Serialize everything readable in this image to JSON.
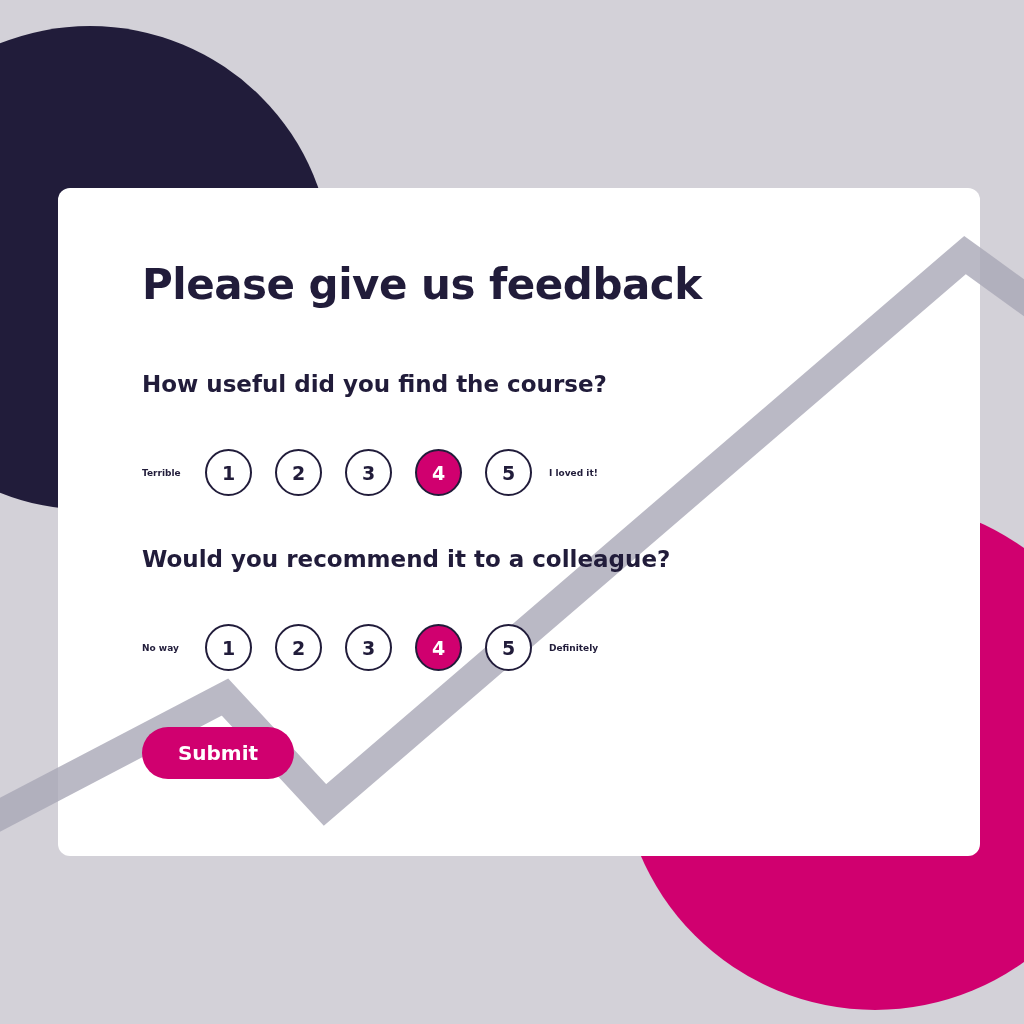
{
  "form": {
    "title": "Please give us feedback",
    "questions": [
      {
        "text": "How useful did you find the course?",
        "low_label": "Terrible",
        "high_label": "I loved it!",
        "options": [
          {
            "label": "1",
            "selected": false
          },
          {
            "label": "2",
            "selected": false
          },
          {
            "label": "3",
            "selected": false
          },
          {
            "label": "4",
            "selected": true
          },
          {
            "label": "5",
            "selected": false
          }
        ]
      },
      {
        "text": "Would you recommend it to a colleague?",
        "low_label": "No way",
        "high_label": "Definitely",
        "options": [
          {
            "label": "1",
            "selected": false
          },
          {
            "label": "2",
            "selected": false
          },
          {
            "label": "3",
            "selected": false
          },
          {
            "label": "4",
            "selected": true
          },
          {
            "label": "5",
            "selected": false
          }
        ]
      }
    ],
    "submit": "Submit"
  }
}
